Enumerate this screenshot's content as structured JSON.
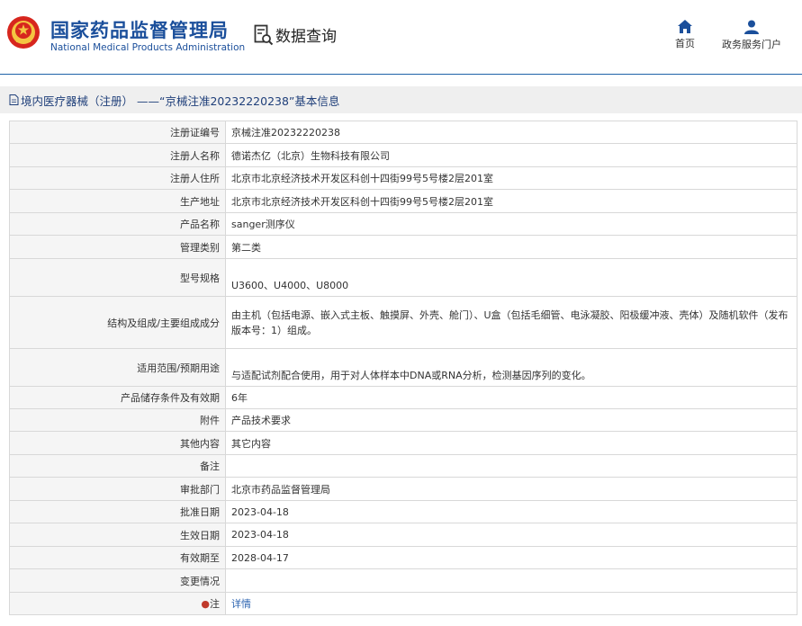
{
  "header": {
    "org_cn": "国家药品监督管理局",
    "org_en": "National Medical Products Administration",
    "section_title": "数据查询",
    "nav": [
      {
        "label": "首页",
        "icon": "home-icon"
      },
      {
        "label": "政务服务门户",
        "icon": "user-icon"
      }
    ]
  },
  "breadcrumb": "境内医疗器械（注册） ——“京械注准20232220238”基本信息",
  "rows": [
    {
      "label": "注册证编号",
      "value": "京械注准20232220238"
    },
    {
      "label": "注册人名称",
      "value": "德诺杰亿（北京）生物科技有限公司"
    },
    {
      "label": "注册人住所",
      "value": "北京市北京经济技术开发区科创十四街99号5号楼2层201室"
    },
    {
      "label": "生产地址",
      "value": "北京市北京经济技术开发区科创十四街99号5号楼2层201室"
    },
    {
      "label": "产品名称",
      "value": "sanger测序仪"
    },
    {
      "label": "管理类别",
      "value": "第二类"
    },
    {
      "label": "型号规格",
      "value": "U3600、U4000、U8000"
    },
    {
      "label": "结构及组成/主要组成成分",
      "value": "由主机（包括电源、嵌入式主板、触摸屏、外壳、舱门）、U盒（包括毛细管、电泳凝胶、阳极缓冲液、壳体）及随机软件（发布版本号：1）组成。"
    },
    {
      "label": "适用范围/预期用途",
      "value": "与适配试剂配合使用，用于对人体样本中DNA或RNA分析，检测基因序列的变化。"
    },
    {
      "label": "产品储存条件及有效期",
      "value": "6年"
    },
    {
      "label": "附件",
      "value": "产品技术要求"
    },
    {
      "label": "其他内容",
      "value": "其它内容"
    },
    {
      "label": "备注",
      "value": ""
    },
    {
      "label": "审批部门",
      "value": "北京市药品监督管理局"
    },
    {
      "label": "批准日期",
      "value": "2023-04-18"
    },
    {
      "label": "生效日期",
      "value": "2023-04-18"
    },
    {
      "label": "有效期至",
      "value": "2028-04-17"
    },
    {
      "label": "变更情况",
      "value": ""
    },
    {
      "label": "注",
      "value": "详情"
    }
  ],
  "colors": {
    "brand": "#1b4f9b",
    "accent_line": "#1f63a8",
    "link": "#2b63b0"
  }
}
